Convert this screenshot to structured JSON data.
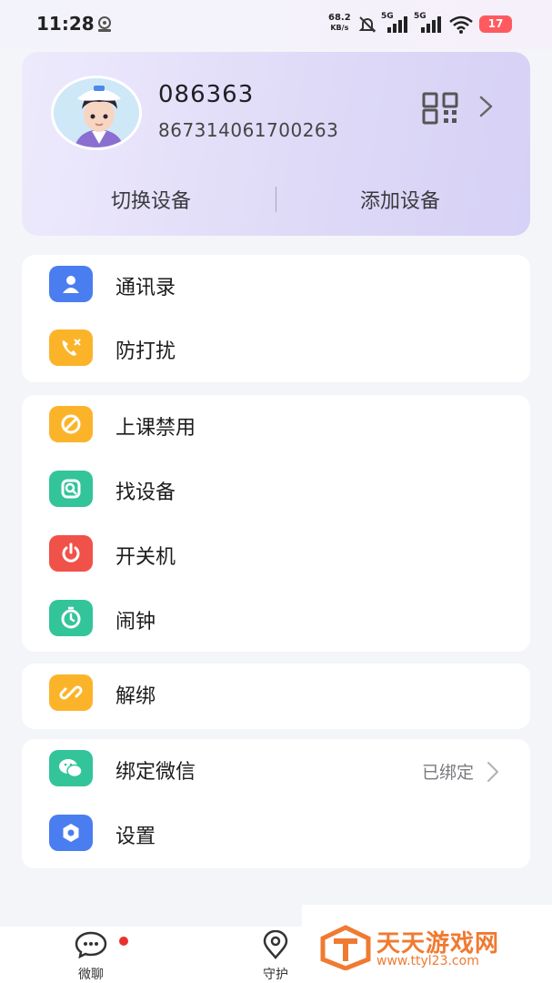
{
  "status": {
    "time": "11:28",
    "speed_value": "68.2",
    "speed_unit": "KB/s",
    "net1": "5G",
    "net2": "5G",
    "battery": "17"
  },
  "profile": {
    "device_name": "086363",
    "device_id": "867314061700263",
    "switch_label": "切换设备",
    "add_label": "添加设备"
  },
  "groups": [
    {
      "items": [
        {
          "label": "通讯录",
          "icon": "contacts-icon",
          "color": "#4a7df0"
        },
        {
          "label": "防打扰",
          "icon": "do-not-disturb-icon",
          "color": "#fbb42a"
        }
      ]
    },
    {
      "items": [
        {
          "label": "上课禁用",
          "icon": "class-disable-icon",
          "color": "#fbb42a"
        },
        {
          "label": "找设备",
          "icon": "find-device-icon",
          "color": "#33c49a"
        },
        {
          "label": "开关机",
          "icon": "power-icon",
          "color": "#f0524a"
        },
        {
          "label": "闹钟",
          "icon": "alarm-icon",
          "color": "#33c49a"
        }
      ]
    },
    {
      "items": [
        {
          "label": "解绑",
          "icon": "unbind-icon",
          "color": "#fbb42a"
        }
      ]
    },
    {
      "items": [
        {
          "label": "绑定微信",
          "icon": "wechat-icon",
          "color": "#33c49a",
          "value": "已绑定"
        },
        {
          "label": "设置",
          "icon": "settings-icon",
          "color": "#4a7df0"
        }
      ]
    }
  ],
  "tabs": [
    {
      "label": "微聊",
      "icon": "chat-icon"
    },
    {
      "label": "守护",
      "icon": "location-pin-icon"
    }
  ],
  "watermark": {
    "title": "天天游戏网",
    "url": "www.ttyl23.com"
  }
}
